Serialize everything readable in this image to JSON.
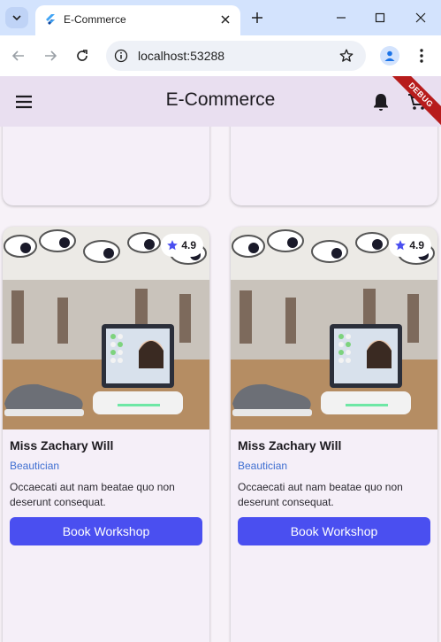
{
  "browser": {
    "tab_title": "E-Commerce",
    "url": "localhost:53288"
  },
  "app": {
    "title": "E-Commerce",
    "debug_label": "DEBUG"
  },
  "cards": [
    {
      "rating": "4.9",
      "name": "Miss Zachary Will",
      "role": "Beautician",
      "description": "Occaecati aut nam beatae quo non deserunt consequat.",
      "button_label": "Book Workshop"
    },
    {
      "rating": "4.9",
      "name": "Miss Zachary Will",
      "role": "Beautician",
      "description": "Occaecati aut nam beatae quo non deserunt consequat.",
      "button_label": "Book Workshop"
    }
  ],
  "colors": {
    "app_bar": "#e9dff0",
    "button": "#4a4ff0",
    "role_text": "#3f6fd1",
    "star": "#4a4ff0"
  }
}
